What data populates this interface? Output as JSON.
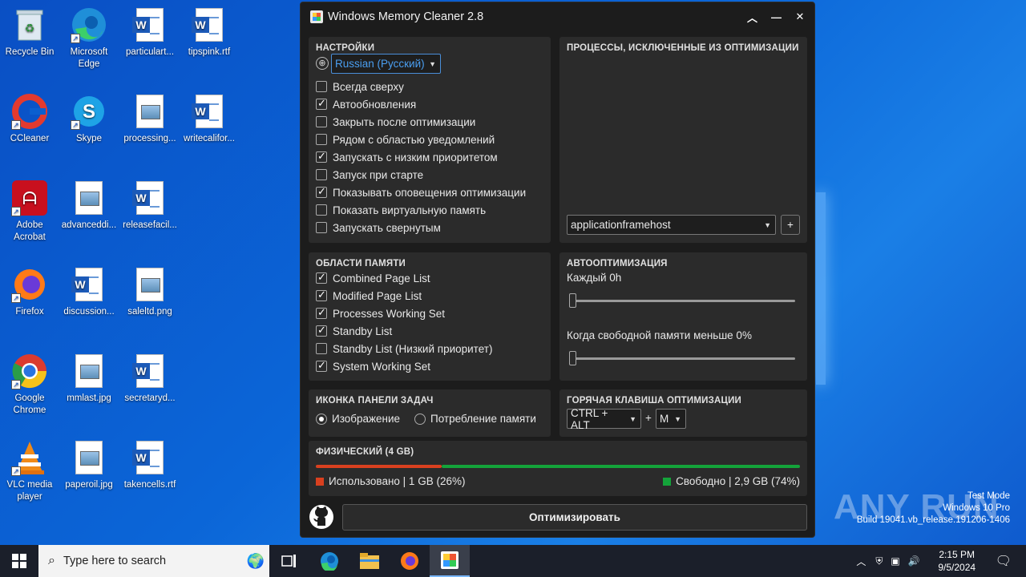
{
  "desktop": {
    "icons": [
      {
        "label": "Recycle Bin"
      },
      {
        "label": "Microsoft Edge"
      },
      {
        "label": "particulart..."
      },
      {
        "label": "tipspink.rtf"
      },
      {
        "label": "CCleaner"
      },
      {
        "label": "Skype"
      },
      {
        "label": "processing..."
      },
      {
        "label": "writecalifor..."
      },
      {
        "label": "Adobe Acrobat"
      },
      {
        "label": "advanceddi..."
      },
      {
        "label": "releasefacil..."
      },
      {
        "label": "Firefox"
      },
      {
        "label": "discussion..."
      },
      {
        "label": "saleltd.png"
      },
      {
        "label": "Google Chrome"
      },
      {
        "label": "mmlast.jpg"
      },
      {
        "label": "secretaryd..."
      },
      {
        "label": "VLC media player"
      },
      {
        "label": "paperoil.jpg"
      },
      {
        "label": "takencells.rtf"
      }
    ]
  },
  "app": {
    "title": "Windows Memory Cleaner 2.8",
    "settings": {
      "heading": "НАСТРОЙКИ",
      "language": "Russian (Русский)",
      "options": [
        {
          "label": "Всегда сверху",
          "checked": false
        },
        {
          "label": "Автообновления",
          "checked": true
        },
        {
          "label": "Закрыть после оптимизации",
          "checked": false
        },
        {
          "label": "Рядом с областью уведомлений",
          "checked": false
        },
        {
          "label": "Запускать с низким приоритетом",
          "checked": true
        },
        {
          "label": "Запуск при старте",
          "checked": false
        },
        {
          "label": "Показывать оповещения оптимизации",
          "checked": true
        },
        {
          "label": "Показать виртуальную память",
          "checked": false
        },
        {
          "label": "Запускать свернутым",
          "checked": false
        }
      ]
    },
    "excluded": {
      "heading": "ПРОЦЕССЫ, ИСКЛЮЧЕННЫЕ ИЗ ОПТИМИЗАЦИИ",
      "process_value": "applicationframehost",
      "add_label": "+"
    },
    "memory_areas": {
      "heading": "ОБЛАСТИ ПАМЯТИ",
      "options": [
        {
          "label": "Combined Page List",
          "checked": true
        },
        {
          "label": "Modified Page List",
          "checked": true
        },
        {
          "label": "Processes Working Set",
          "checked": true
        },
        {
          "label": "Standby List",
          "checked": true
        },
        {
          "label": "Standby List (Низкий приоритет)",
          "checked": false
        },
        {
          "label": "System Working Set",
          "checked": true
        }
      ]
    },
    "auto": {
      "heading": "АВТООПТИМИЗАЦИЯ",
      "every_label": "Каждый 0h",
      "every_value": 0,
      "free_label": "Когда свободной памяти меньше 0%",
      "free_value": 0
    },
    "tray_icon": {
      "heading": "ИКОНКА ПАНЕЛИ ЗАДАЧ",
      "opt_image": "Изображение",
      "opt_usage": "Потребление памяти",
      "selected": "image"
    },
    "hotkey": {
      "heading": "ГОРЯЧАЯ КЛАВИША ОПТИМИЗАЦИИ",
      "modifier": "CTRL + ALT",
      "plus": "+",
      "key": "M"
    },
    "physical": {
      "heading": "ФИЗИЧЕСКИЙ (4 GB)",
      "used_label": "Использовано | 1 GB (26%)",
      "free_label": "Свободно | 2,9 GB (74%)",
      "used_percent": 26,
      "used_color": "#d9401f",
      "free_color": "#14a33a"
    },
    "optimize_label": "Оптимизировать"
  },
  "watermark": {
    "brand": "ANY RUN",
    "line1": "Test Mode",
    "line2": "Windows 10 Pro",
    "line3": "Build 19041.vb_release.191206-1406"
  },
  "taskbar": {
    "search_placeholder": "Type here to search",
    "time": "2:15 PM",
    "date": "9/5/2024"
  }
}
